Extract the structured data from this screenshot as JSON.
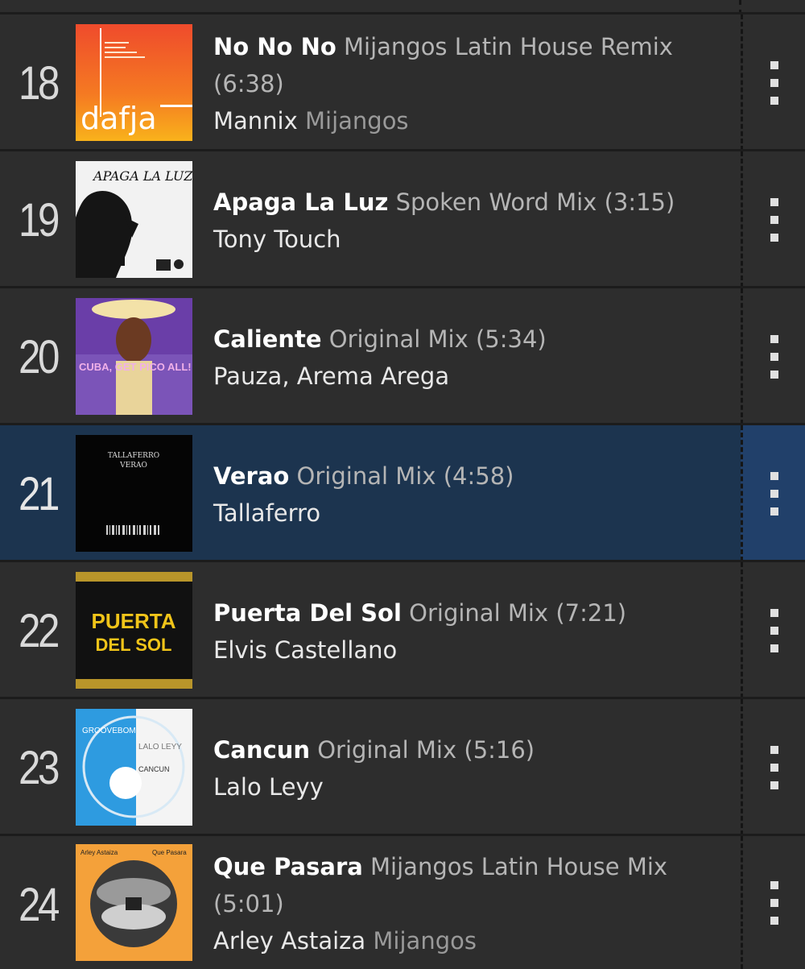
{
  "tracks": [
    {
      "rank": "18",
      "title": "No No No",
      "mix": "Mijangos Latin House Remix",
      "duration": "(6:38)",
      "artist": "Mannix",
      "remixer": "Mijangos",
      "selected": false
    },
    {
      "rank": "19",
      "title": "Apaga La Luz",
      "mix": "Spoken Word Mix",
      "duration": "(3:15)",
      "artist": "Tony Touch",
      "remixer": "",
      "selected": false
    },
    {
      "rank": "20",
      "title": "Caliente",
      "mix": "Original Mix",
      "duration": "(5:34)",
      "artist": "Pauza, Arema Arega",
      "remixer": "",
      "selected": false
    },
    {
      "rank": "21",
      "title": "Verao",
      "mix": "Original Mix",
      "duration": "(4:58)",
      "artist": "Tallaferro",
      "remixer": "",
      "selected": true
    },
    {
      "rank": "22",
      "title": "Puerta Del Sol",
      "mix": "Original Mix",
      "duration": "(7:21)",
      "artist": "Elvis Castellano",
      "remixer": "",
      "selected": false
    },
    {
      "rank": "23",
      "title": "Cancun",
      "mix": "Original Mix",
      "duration": "(5:16)",
      "artist": "Lalo Leyy",
      "remixer": "",
      "selected": false
    },
    {
      "rank": "24",
      "title": "Que Pasara",
      "mix": "Mijangos Latin House Mix",
      "duration": "(5:01)",
      "artist": "Arley Astaiza",
      "remixer": "Mijangos",
      "selected": false
    }
  ],
  "cover_text": {
    "t18": "dafja",
    "t19": "APAGA LA LUZ",
    "t20": "CUBA, GET PICO ALL!",
    "t21a": "TALLAFERRO",
    "t21b": "VERAO",
    "t22a": "PUERTA",
    "t22b": "DEL SOL",
    "t23a": "GROOVEBOM",
    "t23b": "LALO LEYY",
    "t23c": "CANCUN",
    "t24a": "Arley Astaiza",
    "t24b": "Que Pasara"
  },
  "colors": {
    "background": "#2d2d2d",
    "selected_row": "#1c344f",
    "selected_menu": "#21406a"
  },
  "icons": {
    "row_menu": "kebab-menu-icon"
  }
}
